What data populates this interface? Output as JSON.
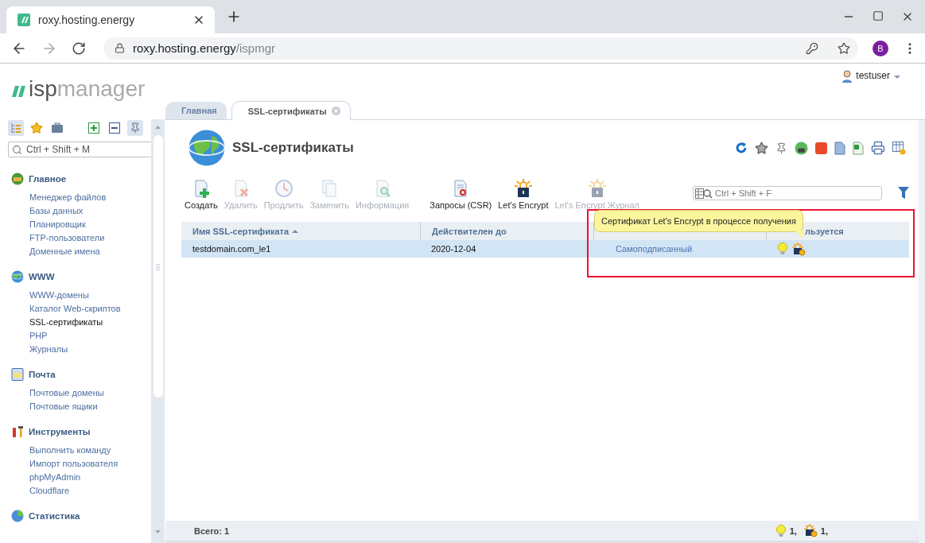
{
  "browser": {
    "tab_title": "roxy.hosting.energy",
    "url_host": "roxy.hosting.energy",
    "url_path": "/ispmgr",
    "profile_letter": "B"
  },
  "logo": {
    "first": "isp",
    "second": "manager"
  },
  "user": {
    "name": "testuser"
  },
  "tabs": [
    {
      "label": "Главная",
      "selected": false,
      "closable": false
    },
    {
      "label": "SSL-сертификаты",
      "selected": true,
      "closable": true
    }
  ],
  "sidebar": {
    "search": {
      "placeholder": "Ctrl + Shift + M"
    },
    "sections": [
      {
        "kind": "home",
        "title": "Главное",
        "items": [
          {
            "label": "Менеджер файлов",
            "selected": false
          },
          {
            "label": "Базы данных",
            "selected": false
          },
          {
            "label": "Планировщик",
            "selected": false
          },
          {
            "label": "FTP-пользователи",
            "selected": false
          },
          {
            "label": "Доменные имена",
            "selected": false
          }
        ]
      },
      {
        "kind": "www",
        "title": "WWW",
        "items": [
          {
            "label": "WWW-домены",
            "selected": false
          },
          {
            "label": "Каталог Web-скриптов",
            "selected": false
          },
          {
            "label": "SSL-сертификаты",
            "selected": true
          },
          {
            "label": "PHP",
            "selected": false
          },
          {
            "label": "Журналы",
            "selected": false
          }
        ]
      },
      {
        "kind": "mail",
        "title": "Почта",
        "items": [
          {
            "label": "Почтовые домены",
            "selected": false
          },
          {
            "label": "Почтовые ящики",
            "selected": false
          }
        ]
      },
      {
        "kind": "tools",
        "title": "Инструменты",
        "items": [
          {
            "label": "Выполнить команду",
            "selected": false
          },
          {
            "label": "Импорт пользователя",
            "selected": false
          },
          {
            "label": "phpMyAdmin",
            "selected": false
          },
          {
            "label": "Cloudflare",
            "selected": false
          }
        ]
      },
      {
        "kind": "stats",
        "title": "Статистика"
      }
    ]
  },
  "page": {
    "title": "SSL-сертификаты",
    "toolbar_groups": [
      [
        {
          "kind": "create",
          "label": "Создать",
          "disabled": false
        },
        {
          "kind": "delete",
          "label": "Удалить",
          "disabled": true
        },
        {
          "kind": "renew",
          "label": "Продлить",
          "disabled": true
        },
        {
          "kind": "replace",
          "label": "Заменить",
          "disabled": true
        },
        {
          "kind": "info",
          "label": "Информация",
          "disabled": true
        }
      ],
      [
        {
          "kind": "csr",
          "label": "Запросы (CSR)",
          "disabled": false
        },
        {
          "kind": "letsencrypt",
          "label": "Let's Encrypt",
          "disabled": false
        },
        {
          "kind": "letsencrypt",
          "label": "Let's Encrypt Журнал",
          "disabled": true
        }
      ]
    ],
    "filter": {
      "placeholder": "Ctrl + Shift + F"
    },
    "table": {
      "columns": [
        {
          "label": "Имя SSL-сертификата",
          "sorted": true
        },
        {
          "label": "Действителен до",
          "sorted": false
        },
        {
          "sorted": false
        },
        {
          "label": "льзуется",
          "sorted": false
        }
      ],
      "rows": [
        {
          "selected": true,
          "name": "testdomain.com_le1",
          "expires": "2020-12-04",
          "type": "Самоподписанный",
          "status_icons": [
            {
              "kind": "active"
            },
            {
              "kind": "letsencrypt"
            }
          ]
        }
      ]
    },
    "tooltip": "Сертификат Let's Encrypt в процессе получения",
    "footer": {
      "total": "Всего: 1",
      "counts": [
        {
          "kind": "active",
          "text": "1,"
        },
        {
          "kind": "letsencrypt",
          "text": "1,"
        }
      ]
    }
  }
}
